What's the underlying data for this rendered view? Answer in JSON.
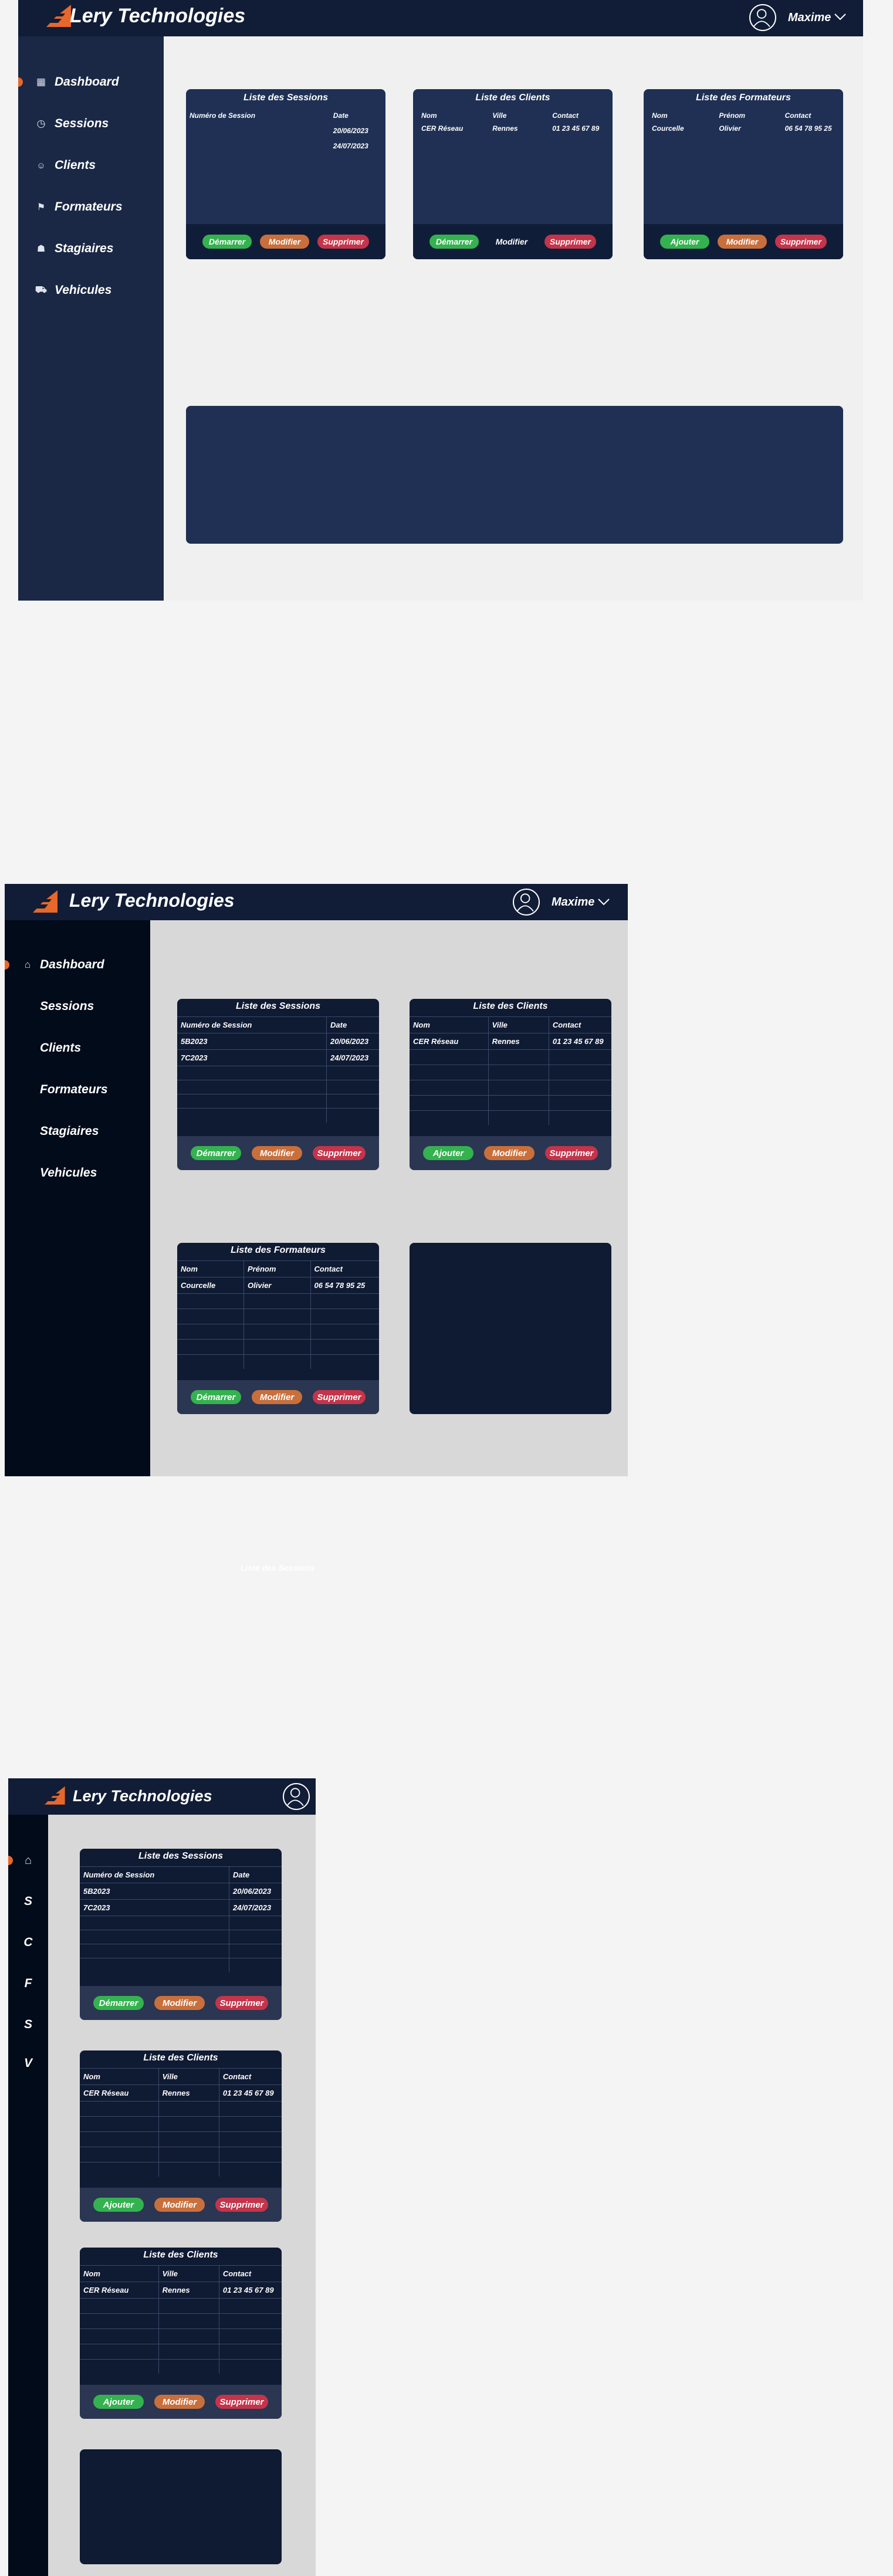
{
  "app": {
    "brand": "Lery Technologies",
    "user": "Maxime",
    "colors": {
      "header": "#111d36",
      "sidebar_light": "#1a2845",
      "sidebar_dark": "#020b1a",
      "card": "#1f3054",
      "card_dark": "#0f1a33",
      "accent": "#e8672a",
      "green": "#34b24f",
      "orange": "#c96f3c",
      "red": "#c4344a"
    }
  },
  "nav": {
    "dashboard": "Dashboard",
    "sessions": "Sessions",
    "clients": "Clients",
    "formateurs": "Formateurs",
    "stagiaires": "Stagiaires",
    "vehicules": "Vehicules",
    "icons": [
      "dashboard-icon",
      "clock-icon",
      "clients-icon",
      "formateurs-icon",
      "stagiaires-icon",
      "vehicule-icon"
    ],
    "short": {
      "sessions": "S",
      "clients": "C",
      "formateurs": "F",
      "stagiaires": "S",
      "vehicules": "V"
    }
  },
  "cards": {
    "sessions": {
      "title": "Liste des Sessions",
      "headers": [
        "Numéro de Session",
        "Date"
      ],
      "rows": [
        [
          "5B2023",
          "20/06/2023"
        ],
        [
          "7C2023",
          "24/07/2023"
        ]
      ]
    },
    "clients": {
      "title": "Liste des Clients",
      "headers": [
        "Nom",
        "Ville",
        "Contact"
      ],
      "rows": [
        [
          "CER Réseau",
          "Rennes",
          "01 23 45 67 89"
        ]
      ]
    },
    "formateurs": {
      "title": "Liste des Formateurs",
      "headers": [
        "Nom",
        "Prénom",
        "Contact"
      ],
      "rows": [
        [
          "Courcelle",
          "Olivier",
          "06 54 78 95 25"
        ]
      ]
    }
  },
  "buttons": {
    "demarrer": "Démarrer",
    "ajouter": "Ajouter",
    "modifier": "Modifier",
    "supprimer": "Supprimer"
  },
  "ghost_text": "Liste des Sessions"
}
